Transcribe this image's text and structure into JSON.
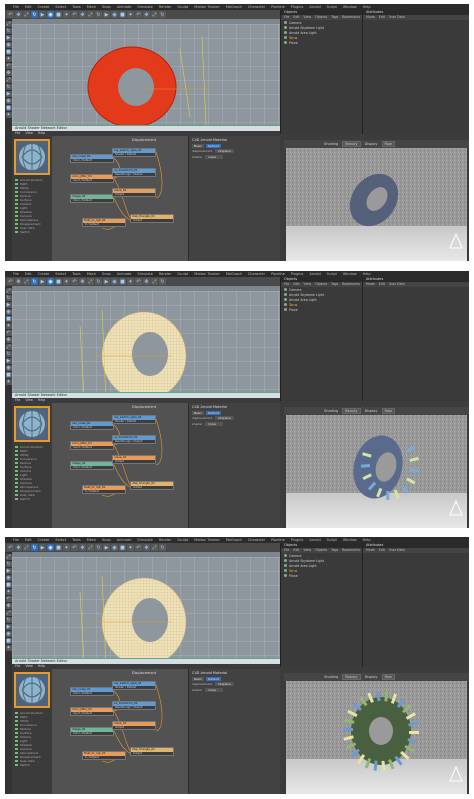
{
  "app": {
    "menu": [
      "File",
      "Edit",
      "Create",
      "Select",
      "Tools",
      "Mesh",
      "Snap",
      "Animate",
      "Simulate",
      "Render",
      "Sculpt",
      "Motion Tracker",
      "MoGraph",
      "Character",
      "Pipeline",
      "Plugins",
      "Arnold",
      "Script",
      "Window",
      "Help"
    ],
    "layout_label": "Layout: Arnold_Startup"
  },
  "frames": [
    {
      "id": "frame-1",
      "torus_style": "red",
      "object_panel": {
        "tabs": [
          "Objects",
          "Takes",
          "Content Browser"
        ],
        "menu": [
          "File",
          "Edit",
          "View",
          "Objects",
          "Tags",
          "Bookmarks"
        ],
        "objects": [
          "Camera",
          "Arnold Skydome Light",
          "Arnold Area Light",
          "Torus",
          "Plane"
        ],
        "selected": "Torus"
      },
      "attr_panel": {
        "tabs": [
          "Attributes",
          "Layers"
        ],
        "menu": [
          "Mode",
          "Edit",
          "User Data"
        ]
      },
      "render_view": {
        "shading_label": "Shading",
        "shading_value": "Beauty",
        "display_label": "Display",
        "display_value": "Raw"
      },
      "shader_editor": {
        "title": "Arnold Shader Network Editor",
        "menu": [
          "File",
          "View",
          "Help"
        ],
        "graph_title": "Displacement",
        "params_title": "C4D Arnold Material",
        "param_tabs": [
          "Basic",
          "Default"
        ],
        "params": [
          {
            "label": "displacement",
            "value": "Displace"
          },
          {
            "label": "shader",
            "value": "Cube"
          }
        ],
        "shader_list": [
          "Arnold shaders",
          "Math",
          "Utility",
          "Conversion",
          "Texture",
          "Surface",
          "Volume",
          "Light",
          "Shadow",
          "Camera",
          "Atmosphere",
          "Displacement",
          "User data",
          "Switch"
        ],
        "nodes": [
          {
            "name": "cell_noise_01",
            "sub": "Color / Default",
            "kind": "blue"
          },
          {
            "name": "ray_switch_rgba_01",
            "sub": "Shader / Default",
            "kind": "blue"
          },
          {
            "name": "color_jitter_01",
            "sub": "Input / Default",
            "kind": "orange"
          },
          {
            "name": "uv_transform_01",
            "sub": "Passthrough / Output",
            "kind": "blue"
          },
          {
            "name": "image_01",
            "sub": "Color / Default",
            "kind": "green"
          },
          {
            "name": "noise_01",
            "sub": "Output",
            "kind": "orange"
          },
          {
            "name": "disp_triangle_01",
            "sub": "Output",
            "kind": "disp"
          },
          {
            "name": "float_to_rgb_01",
            "sub": "R / Default",
            "kind": "orange"
          }
        ]
      }
    },
    {
      "id": "frame-2",
      "torus_style": "wire",
      "object_panel": {
        "tabs": [
          "Objects",
          "Takes",
          "Content Browser"
        ],
        "menu": [
          "File",
          "Edit",
          "View",
          "Objects",
          "Tags",
          "Bookmarks"
        ],
        "objects": [
          "Camera",
          "Arnold Skydome Light",
          "Arnold Area Light",
          "Torus",
          "Plane"
        ],
        "selected": "Torus"
      },
      "attr_panel": {
        "tabs": [
          "Attributes",
          "Layers"
        ],
        "menu": [
          "Mode",
          "Edit",
          "User Data"
        ]
      },
      "render_view": {
        "shading_label": "Shading",
        "shading_value": "Beauty",
        "display_label": "Display",
        "display_value": "Raw"
      },
      "shader_editor": {
        "title": "Arnold Shader Network Editor",
        "menu": [
          "File",
          "View",
          "Help"
        ],
        "graph_title": "Displacement",
        "params_title": "C4D Arnold Material",
        "param_tabs": [
          "Basic",
          "Default"
        ],
        "params": [
          {
            "label": "displacement",
            "value": "Displace"
          },
          {
            "label": "shader",
            "value": "Cube"
          }
        ],
        "shader_list": [
          "Arnold shaders",
          "Math",
          "Utility",
          "Conversion",
          "Texture",
          "Surface",
          "Volume",
          "Light",
          "Shadow",
          "Camera",
          "Atmosphere",
          "Displacement",
          "User data",
          "Switch"
        ],
        "nodes": [
          {
            "name": "cell_noise_01",
            "sub": "Color / Default",
            "kind": "blue"
          },
          {
            "name": "ray_switch_rgba_01",
            "sub": "Shader / Default",
            "kind": "blue"
          },
          {
            "name": "color_jitter_01",
            "sub": "Input / Default",
            "kind": "orange"
          },
          {
            "name": "uv_transform_01",
            "sub": "Passthrough / Output",
            "kind": "blue"
          },
          {
            "name": "image_01",
            "sub": "Color / Default",
            "kind": "green"
          },
          {
            "name": "noise_01",
            "sub": "Output",
            "kind": "orange"
          },
          {
            "name": "disp_triangle_01",
            "sub": "Output",
            "kind": "disp"
          },
          {
            "name": "float_to_rgb_01",
            "sub": "R / Default",
            "kind": "orange"
          }
        ]
      }
    },
    {
      "id": "frame-3",
      "torus_style": "wire",
      "object_panel": {
        "tabs": [
          "Objects",
          "Takes",
          "Content Browser"
        ],
        "menu": [
          "File",
          "Edit",
          "View",
          "Objects",
          "Tags",
          "Bookmarks"
        ],
        "objects": [
          "Camera",
          "Arnold Skydome Light",
          "Arnold Area Light",
          "Torus",
          "Plane"
        ],
        "selected": "Torus"
      },
      "attr_panel": {
        "tabs": [
          "Attributes",
          "Layers"
        ],
        "menu": [
          "Mode",
          "Edit",
          "User Data"
        ]
      },
      "render_view": {
        "shading_label": "Shading",
        "shading_value": "Beauty",
        "display_label": "Display",
        "display_value": "Raw"
      },
      "shader_editor": {
        "title": "Arnold Shader Network Editor",
        "menu": [
          "File",
          "View",
          "Help"
        ],
        "graph_title": "Displacement",
        "params_title": "C4D Arnold Material",
        "param_tabs": [
          "Basic",
          "Default"
        ],
        "params": [
          {
            "label": "displacement",
            "value": "Displace"
          },
          {
            "label": "shader",
            "value": "Cube"
          }
        ],
        "shader_list": [
          "Arnold shaders",
          "Math",
          "Utility",
          "Conversion",
          "Texture",
          "Surface",
          "Volume",
          "Light",
          "Shadow",
          "Camera",
          "Atmosphere",
          "Displacement",
          "User data",
          "Switch"
        ],
        "nodes": [
          {
            "name": "cell_noise_01",
            "sub": "Color / Default",
            "kind": "blue"
          },
          {
            "name": "ray_switch_rgba_01",
            "sub": "Shader / Default",
            "kind": "blue"
          },
          {
            "name": "color_jitter_01",
            "sub": "Input / Default",
            "kind": "orange"
          },
          {
            "name": "uv_transform_01",
            "sub": "Passthrough / Output",
            "kind": "blue"
          },
          {
            "name": "image_01",
            "sub": "Color / Default",
            "kind": "green"
          },
          {
            "name": "noise_01",
            "sub": "Output",
            "kind": "orange"
          },
          {
            "name": "disp_triangle_01",
            "sub": "Output",
            "kind": "disp"
          },
          {
            "name": "float_to_rgb_01",
            "sub": "R / Default",
            "kind": "orange"
          }
        ]
      }
    }
  ],
  "colors": {
    "accent": "#e59a2c",
    "selection": "#2d6fb8",
    "viewport": "#8e969e"
  },
  "icons": [
    "undo-icon",
    "move-icon",
    "scale-icon",
    "rotate-icon",
    "render-icon",
    "camera-icon",
    "cube-icon",
    "light-icon"
  ]
}
